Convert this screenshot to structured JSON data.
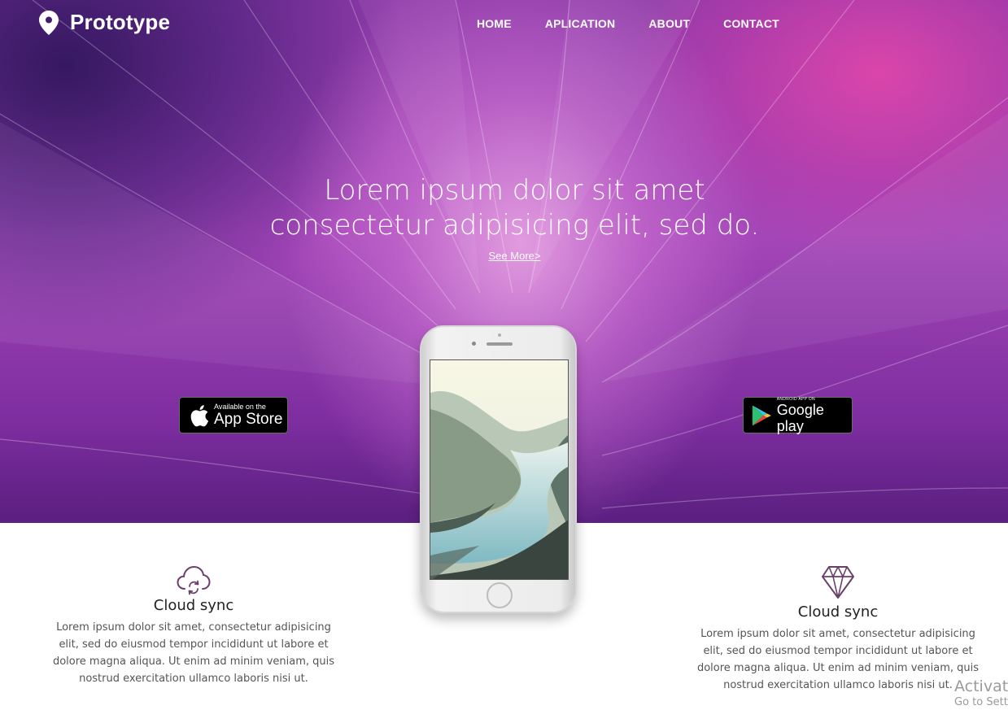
{
  "header": {
    "brand": "Prototype",
    "nav": [
      "HOME",
      "APLICATION",
      "ABOUT",
      "CONTACT"
    ]
  },
  "hero": {
    "headline_line1": "Lorem ipsum dolor sit amet",
    "headline_line2": "consectetur adipisicing elit, sed do.",
    "see_more": "See More>"
  },
  "badges": {
    "appstore_small": "Available on the",
    "appstore_big": "App Store",
    "gplay_small": "ANDROID APP ON",
    "gplay_big": "Google play"
  },
  "features": [
    {
      "icon": "cloud-sync-icon",
      "title": "Cloud sync",
      "desc": "Lorem ipsum dolor sit amet, consectetur adipisicing elit, sed do eiusmod tempor incididunt ut labore et dolore magna aliqua. Ut enim ad minim veniam, quis nostrud exercitation ullamco laboris nisi ut."
    },
    {
      "icon": "diamond-icon",
      "title": "Cloud sync",
      "desc": "Lorem ipsum dolor sit amet, consectetur adipisicing elit, sed do eiusmod tempor incididunt ut labore et dolore magna aliqua. Ut enim ad minim veniam, quis nostrud exercitation ullamco laboris nisi ut."
    }
  ],
  "watermark": {
    "line1": "Activate",
    "line2": "Go to Sett"
  },
  "colors": {
    "hero_primary": "#a446b8",
    "hero_dark": "#3a1a6e",
    "hero_pink": "#e046aa",
    "icon_purple": "#6b3f6b",
    "text_dark": "#222222",
    "text_muted": "#555555"
  }
}
